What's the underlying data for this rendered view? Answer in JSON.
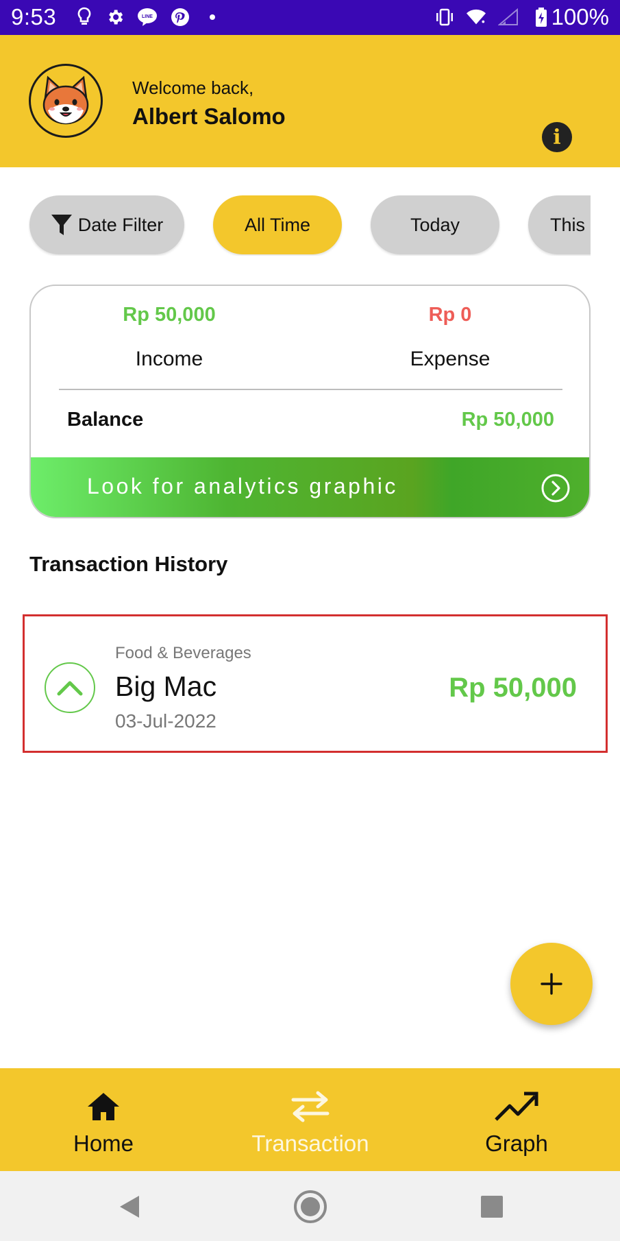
{
  "status_bar": {
    "time": "9:53",
    "battery": "100%"
  },
  "header": {
    "welcome": "Welcome back,",
    "user_name": "Albert Salomo",
    "avatar": "shiba-inu-dog-icon"
  },
  "filters": {
    "date_filter": "Date Filter",
    "chips": [
      "All Time",
      "Today",
      "This"
    ],
    "active": "All Time"
  },
  "summary": {
    "income_value": "Rp 50,000",
    "income_label": "Income",
    "expense_value": "Rp 0",
    "expense_label": "Expense",
    "balance_label": "Balance",
    "balance_value": "Rp 50,000",
    "analytics_label": "Look for analytics graphic"
  },
  "history": {
    "title": "Transaction History",
    "items": [
      {
        "category": "Food & Beverages",
        "name": "Big Mac",
        "date": "03-Jul-2022",
        "amount": "Rp 50,000",
        "type": "income"
      }
    ]
  },
  "fab": {
    "label": "+"
  },
  "bottom_nav": {
    "items": [
      {
        "label": "Home",
        "icon": "home-icon"
      },
      {
        "label": "Transaction",
        "icon": "swap-arrows-icon"
      },
      {
        "label": "Graph",
        "icon": "trending-up-icon"
      }
    ],
    "active": "Transaction"
  },
  "colors": {
    "primary_yellow": "#f3c72c",
    "status_bar": "#3a08b4",
    "income_green": "#63c84a",
    "expense_red": "#ee5d57",
    "highlight_red": "#d32f2f"
  }
}
